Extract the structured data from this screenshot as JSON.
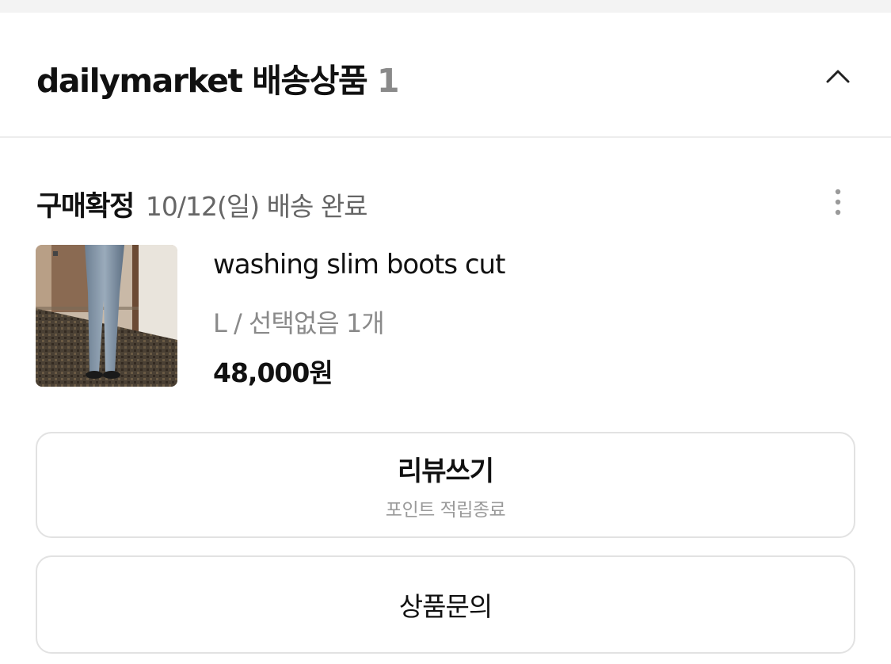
{
  "header": {
    "title": "dailymarket 배송상품",
    "count": "1"
  },
  "order": {
    "status": "구매확정",
    "delivery_info": "10/12(일) 배송 완료"
  },
  "product": {
    "name": "washing slim boots cut",
    "option": "L / 선택없음 1개",
    "price": "48,000원",
    "thumbnail_icon": "jeans-photo"
  },
  "actions": {
    "review_label": "리뷰쓰기",
    "review_sublabel": "포인트 적립종료",
    "inquiry_label": "상품문의"
  },
  "icons": {
    "collapse": "chevron-up-icon",
    "more": "more-vertical-icon"
  },
  "colors": {
    "text_primary": "#111111",
    "text_secondary": "#8a8a8a",
    "border": "#e2e2e2"
  }
}
